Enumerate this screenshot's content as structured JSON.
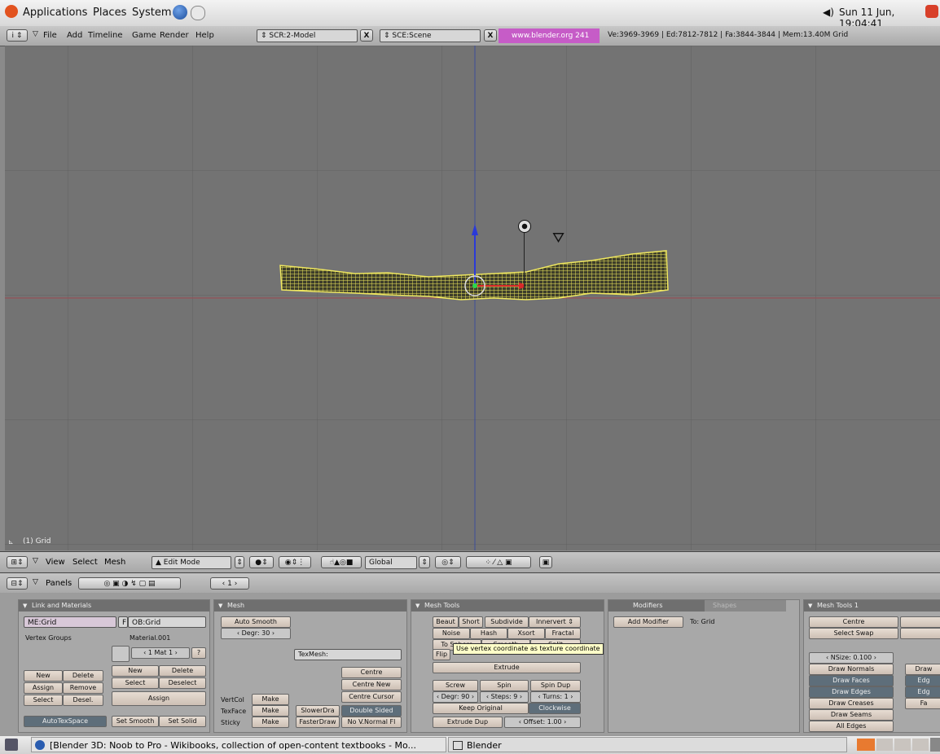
{
  "gnome_panel": {
    "menus": [
      "Applications",
      "Places",
      "System"
    ],
    "clock": "Sun 11 Jun, 19:04:41"
  },
  "blender_header": {
    "menus": [
      "File",
      "Add",
      "Timeline",
      "Game",
      "Render",
      "Help"
    ],
    "screen": "SCR:2-Model",
    "scene": "SCE:Scene",
    "url": "www.blender.org 241",
    "stats": "Ve:3969-3969 | Ed:7812-7812 | Fa:3844-3844 | Mem:13.40M Grid"
  },
  "viewport": {
    "object_label": "(1) Grid"
  },
  "view3d_header": {
    "menus": [
      "View",
      "Select",
      "Mesh"
    ],
    "mode": "Edit Mode",
    "orientation": "Global"
  },
  "buttons_header": {
    "panels_label": "Panels",
    "frame": "1"
  },
  "link_materials": {
    "title": "Link and Materials",
    "me": "ME:Grid",
    "f": "F",
    "ob": "OB:Grid",
    "vertex_groups": "Vertex Groups",
    "material": "Material.001",
    "mat_index": "1 Mat 1",
    "question": "?",
    "new1": "New",
    "delete1": "Delete",
    "assign1": "Assign",
    "remove": "Remove",
    "select1": "Select",
    "desel": "Desel.",
    "new2": "New",
    "delete2": "Delete",
    "select2": "Select",
    "deselect": "Deselect",
    "assign2": "Assign",
    "autotex": "AutoTexSpace",
    "set_smooth": "Set Smooth",
    "set_solid": "Set Solid"
  },
  "mesh": {
    "title": "Mesh",
    "auto_smooth": "Auto Smooth",
    "degr": "Degr: 30",
    "texmesh": "TexMesh:",
    "centre": "Centre",
    "centre_new": "Centre New",
    "centre_cursor": "Centre Cursor",
    "vertcol": "VertCol",
    "texface": "TexFace",
    "sticky": "Sticky",
    "make": "Make",
    "slower": "SlowerDra",
    "faster": "FasterDraw",
    "double_sided": "Double Sided",
    "no_vnormal": "No V.Normal Fl"
  },
  "mesh_tools": {
    "title": "Mesh Tools",
    "beaut": "Beaut",
    "short": "Short",
    "subdivide": "Subdivide",
    "innervert": "Innervert",
    "noise": "Noise",
    "hash": "Hash",
    "xsort": "Xsort",
    "fractal": "Fractal",
    "to_sphere": "To Sphere",
    "smooth": "Smooth",
    "split": "Split",
    "flip": "Flip",
    "extrude": "Extrude",
    "screw": "Screw",
    "spin": "Spin",
    "spin_dup": "Spin Dup",
    "degr": "Degr: 90",
    "steps": "Steps: 9",
    "turns": "Turns: 1",
    "keep_original": "Keep Original",
    "clockwise": "Clockwise",
    "extrude_dup": "Extrude Dup",
    "offset": "Offset: 1.00",
    "tooltip": "Use vertex coordinate as texture coordinate"
  },
  "modifiers": {
    "tab_modifiers": "Modifiers",
    "tab_shapes": "Shapes",
    "add_modifier": "Add Modifier",
    "to": "To: Grid"
  },
  "mesh_tools1": {
    "title": "Mesh Tools 1",
    "centre": "Centre",
    "select_swap": "Select Swap",
    "nsize": "NSize: 0.100",
    "draw_normals": "Draw Normals",
    "draw_faces": "Draw Faces",
    "draw_edges": "Draw Edges",
    "draw_creases": "Draw Creases",
    "draw_seams": "Draw Seams",
    "all_edges": "All Edges",
    "col2": [
      "Draw",
      "Edg",
      "Edg",
      "Fa"
    ]
  },
  "taskbar": {
    "item1": "[Blender 3D: Noob to Pro - Wikibooks, collection of open-content textbooks - Mo...",
    "item2": "Blender"
  }
}
